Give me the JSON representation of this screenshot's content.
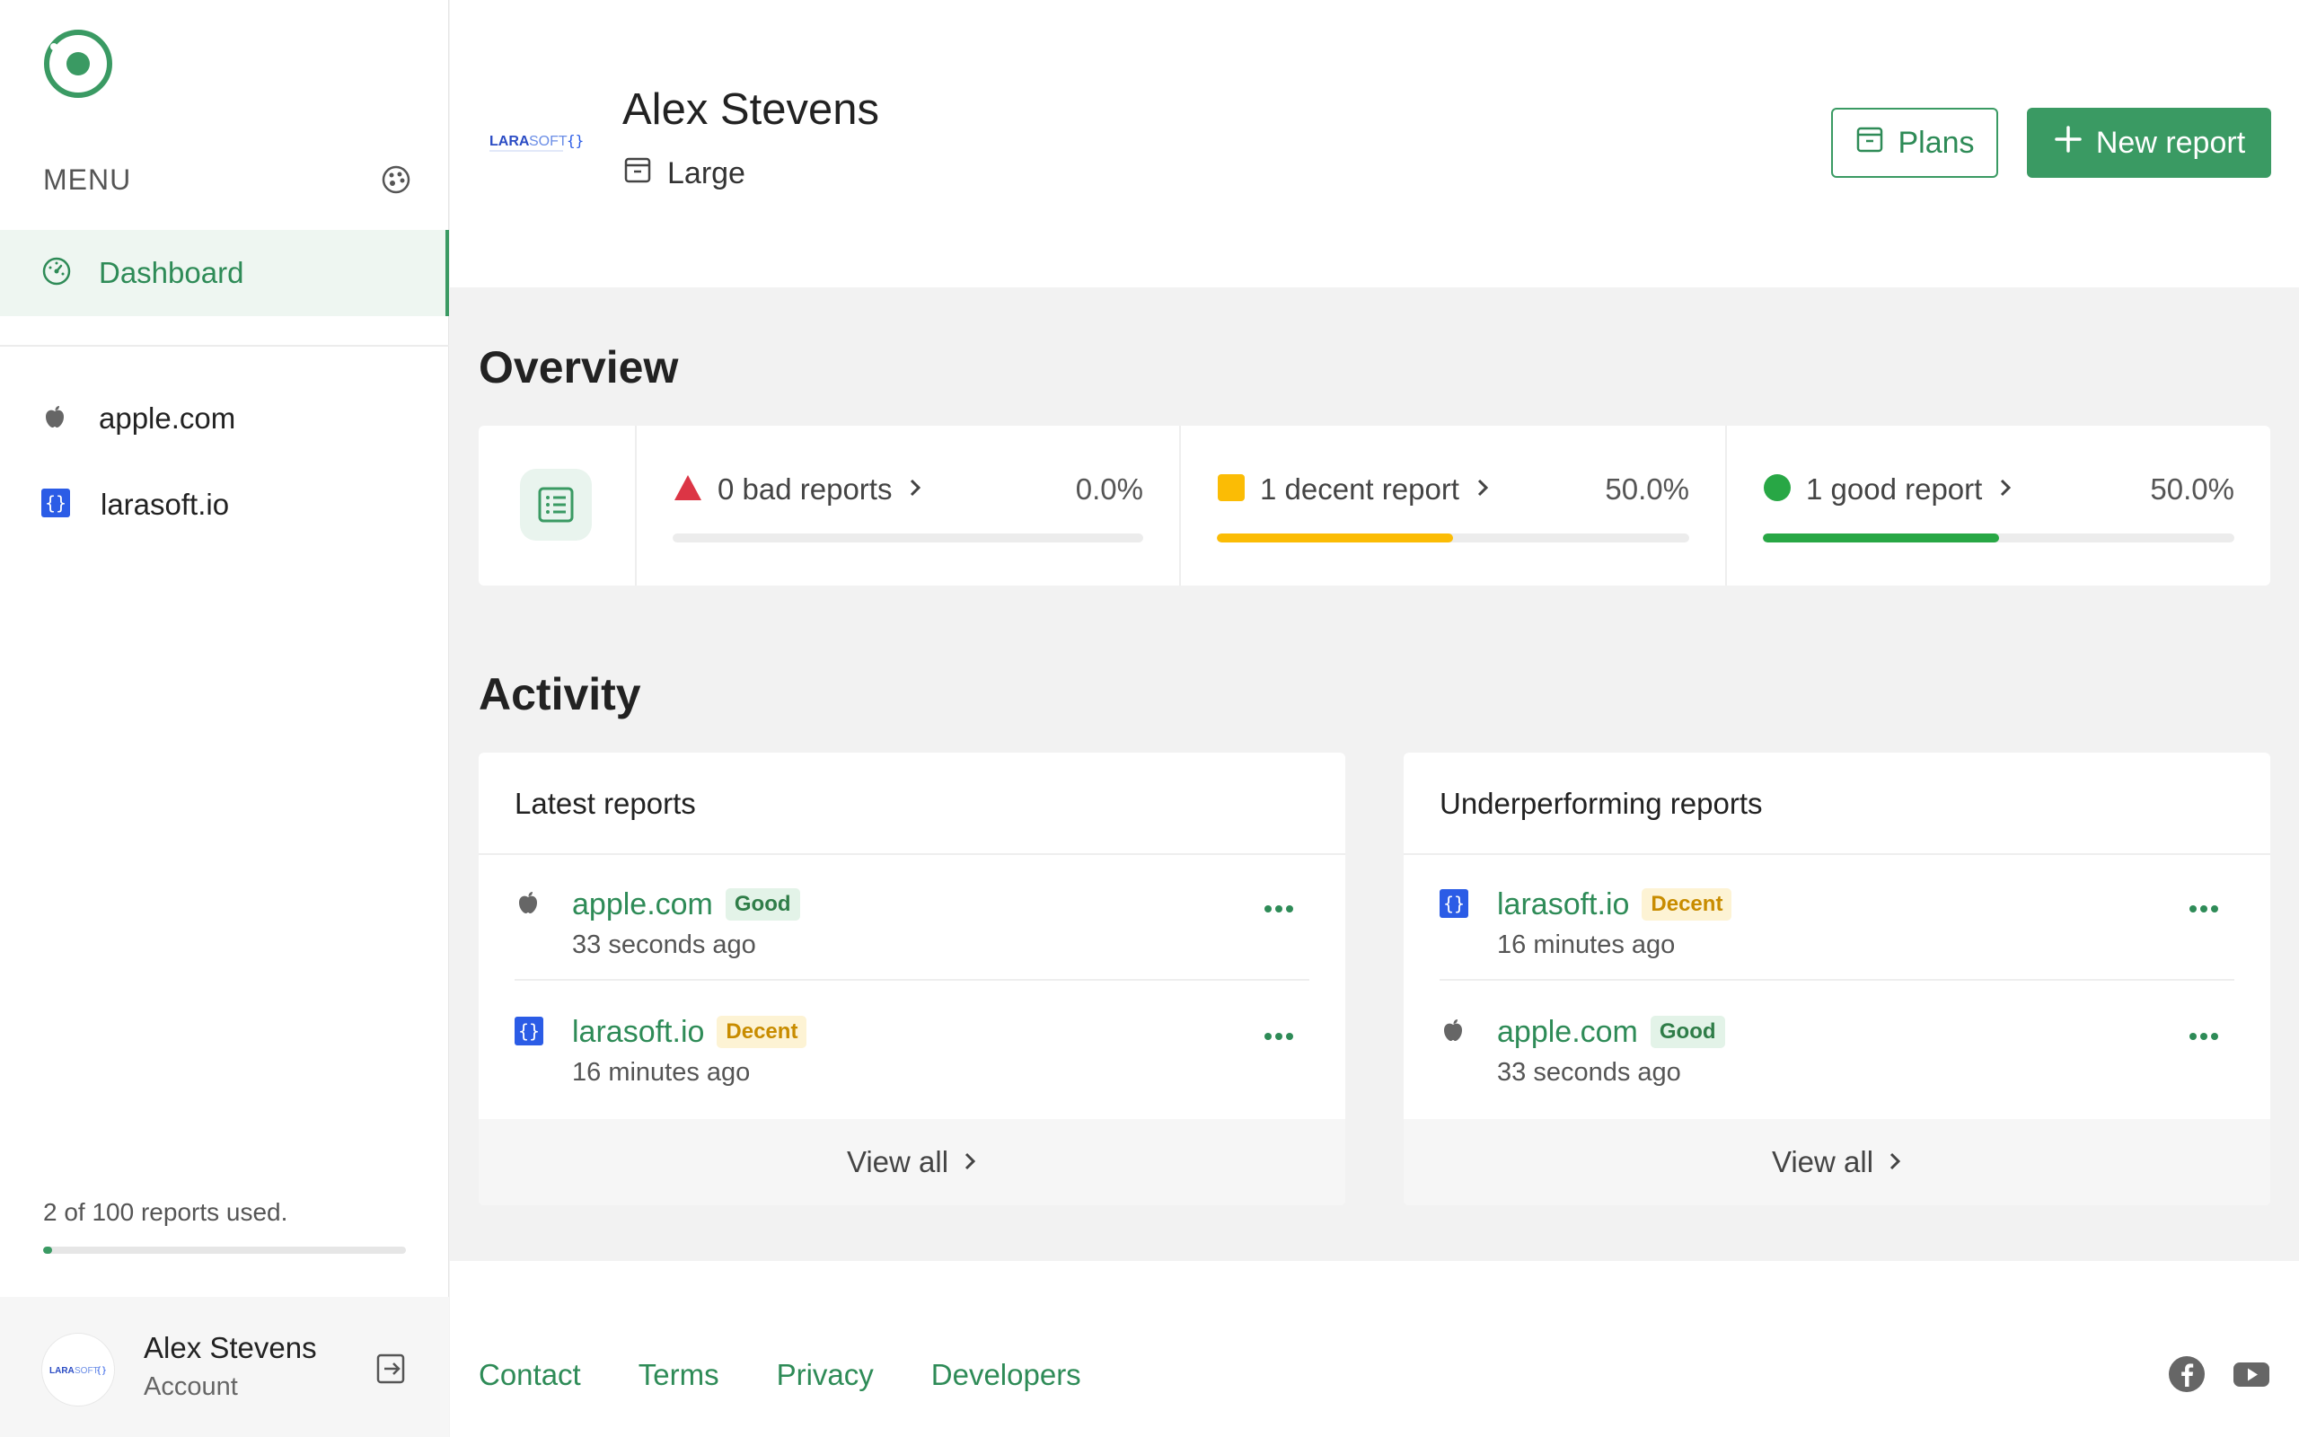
{
  "sidebar": {
    "menu_label": "MENU",
    "nav": {
      "dashboard": "Dashboard"
    },
    "sites": [
      {
        "label": "apple.com",
        "icon": "apple-icon"
      },
      {
        "label": "larasoft.io",
        "icon": "code-braces-icon"
      }
    ],
    "usage_text": "2 of 100 reports used.",
    "usage_fraction": 0.02,
    "account": {
      "name": "Alex Stevens",
      "subtitle": "Account"
    }
  },
  "header": {
    "name": "Alex Stevens",
    "plan": "Large",
    "plans_button": "Plans",
    "new_report_button": "New report"
  },
  "overview": {
    "title": "Overview",
    "stats": [
      {
        "label": "0 bad reports",
        "percent": "0.0%",
        "fraction": 0.0,
        "color": "#dc3545",
        "icon": "triangle-icon"
      },
      {
        "label": "1 decent report",
        "percent": "50.0%",
        "fraction": 0.5,
        "color": "#fbbc05",
        "icon": "square-icon"
      },
      {
        "label": "1 good report",
        "percent": "50.0%",
        "fraction": 0.5,
        "color": "#28a745",
        "icon": "circle-icon"
      }
    ]
  },
  "activity": {
    "title": "Activity",
    "latest": {
      "title": "Latest reports",
      "rows": [
        {
          "site": "apple.com",
          "badge": "Good",
          "time": "33 seconds ago"
        },
        {
          "site": "larasoft.io",
          "badge": "Decent",
          "time": "16 minutes ago"
        }
      ],
      "view_all": "View all"
    },
    "underperforming": {
      "title": "Underperforming reports",
      "rows": [
        {
          "site": "larasoft.io",
          "badge": "Decent",
          "time": "16 minutes ago"
        },
        {
          "site": "apple.com",
          "badge": "Good",
          "time": "33 seconds ago"
        }
      ],
      "view_all": "View all"
    }
  },
  "footer": {
    "links": [
      "Contact",
      "Terms",
      "Privacy",
      "Developers"
    ]
  },
  "colors": {
    "accent": "#3a9a63",
    "accent_text": "#2e8b57",
    "bad": "#dc3545",
    "decent": "#fbbc05",
    "good": "#28a745"
  }
}
